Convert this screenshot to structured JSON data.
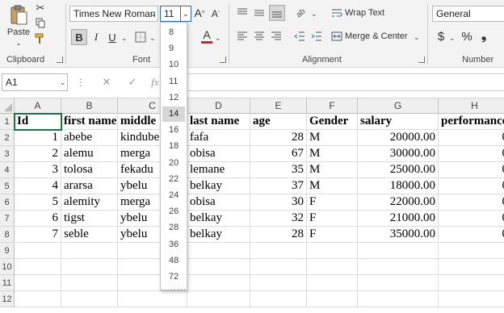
{
  "clipboard": {
    "paste_label": "Paste",
    "group_label": "Clipboard"
  },
  "font": {
    "name_value": "Times New Roman",
    "size_value": "11",
    "bold": "B",
    "italic": "I",
    "underline": "U",
    "grow": "A",
    "shrink": "A",
    "color_letter": "A",
    "group_label": "Font"
  },
  "alignment": {
    "wrap_text": "Wrap Text",
    "merge_center": "Merge & Center",
    "group_label": "Alignment"
  },
  "number": {
    "format_value": "General",
    "currency": "$",
    "percent": "%",
    "comma": "❟",
    "group_label": "Number"
  },
  "formula_bar": {
    "name_box": "A1",
    "cancel": "✕",
    "enter": "✓",
    "fx": "fx"
  },
  "font_size_options": [
    "8",
    "9",
    "10",
    "11",
    "12",
    "14",
    "16",
    "18",
    "20",
    "22",
    "24",
    "26",
    "28",
    "36",
    "48",
    "72"
  ],
  "font_size_hover": "14",
  "dropdown_more": "·····",
  "columns": [
    "A",
    "B",
    "C",
    "D",
    "E",
    "F",
    "G",
    "H"
  ],
  "row_numbers": [
    "1",
    "2",
    "3",
    "4",
    "5",
    "6",
    "7",
    "8",
    "9",
    "10",
    "11",
    "12"
  ],
  "headers": [
    "Id",
    "first name",
    "middle",
    "last name",
    "age",
    "Gender",
    "salary",
    "performance"
  ],
  "rows": [
    [
      "1",
      "abebe",
      "kindube",
      "fafa",
      "28",
      "M",
      "20000.00",
      "0"
    ],
    [
      "2",
      "alemu",
      "merga",
      "obisa",
      "67",
      "M",
      "30000.00",
      "0"
    ],
    [
      "3",
      "tolosa",
      "fekadu",
      "lemane",
      "35",
      "M",
      "25000.00",
      "0"
    ],
    [
      "4",
      "ararsa",
      "ybelu",
      "belkay",
      "37",
      "M",
      "18000.00",
      "0"
    ],
    [
      "5",
      "alemity",
      "merga",
      "obisa",
      "30",
      "F",
      "22000.00",
      "0"
    ],
    [
      "6",
      "tigst",
      "ybelu",
      "belkay",
      "32",
      "F",
      "21000.00",
      "0"
    ],
    [
      "7",
      "seble",
      "ybelu",
      "belkay",
      "28",
      "F",
      "35000.00",
      "0"
    ]
  ],
  "colors": {
    "font_color_bar": "#e02020",
    "dropdown_selected": "#d6d6d6",
    "ribbon_bg": "#f3f3f3"
  }
}
